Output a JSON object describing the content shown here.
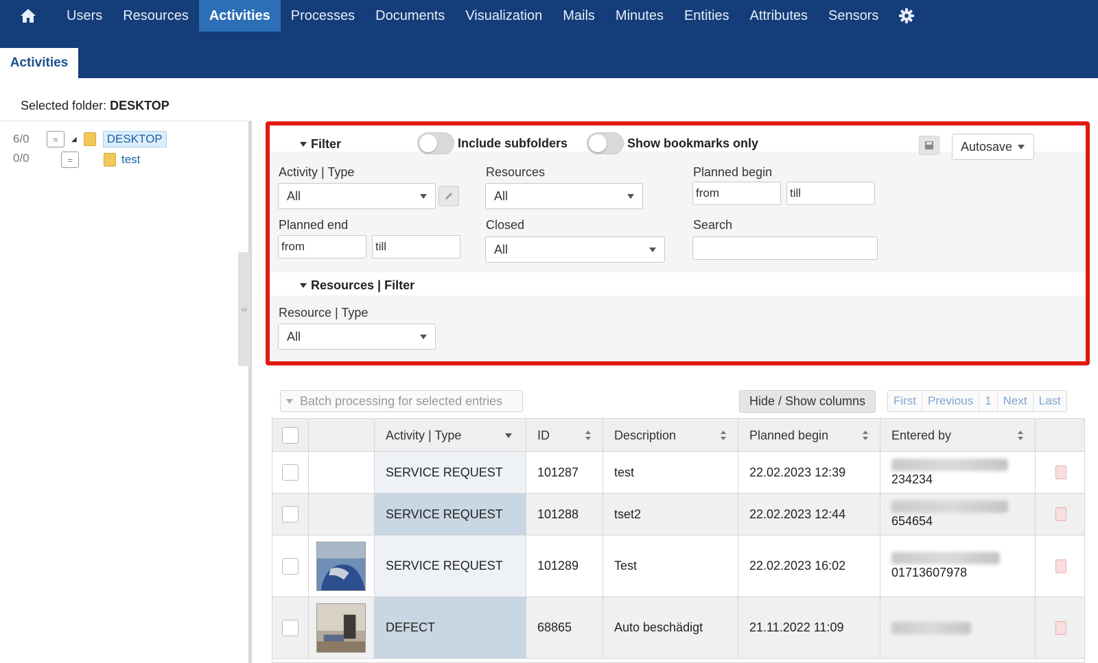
{
  "nav": {
    "items": [
      "Users",
      "Resources",
      "Activities",
      "Processes",
      "Documents",
      "Visualization",
      "Mails",
      "Minutes",
      "Entities",
      "Attributes",
      "Sensors"
    ],
    "active": "Activities"
  },
  "subtab": "Activities",
  "selected_folder": {
    "label": "Selected folder:",
    "value": "DESKTOP"
  },
  "tree": {
    "rows": [
      {
        "count": "6/0",
        "label": "DESKTOP",
        "eq": "="
      },
      {
        "count": "0/0",
        "label": "test",
        "eq": "="
      }
    ]
  },
  "filter": {
    "title": "Filter",
    "include_subfolders": "Include subfolders",
    "show_bookmarks": "Show bookmarks only",
    "autosave": "Autosave",
    "activity_type": {
      "label": "Activity | Type",
      "value": "All"
    },
    "resources": {
      "label": "Resources",
      "value": "All"
    },
    "planned_begin": {
      "label": "Planned begin",
      "from": "from",
      "till": "till"
    },
    "planned_end": {
      "label": "Planned end",
      "from": "from",
      "till": "till"
    },
    "closed": {
      "label": "Closed",
      "value": "All"
    },
    "search": {
      "label": "Search",
      "value": ""
    }
  },
  "resources_filter": {
    "title": "Resources | Filter",
    "resource_type": {
      "label": "Resource | Type",
      "value": "All"
    }
  },
  "toolbar": {
    "batch": "Batch processing for selected entries",
    "hide_show": "Hide / Show columns",
    "pager": [
      "First",
      "Previous",
      "1",
      "Next",
      "Last"
    ]
  },
  "table": {
    "columns": [
      "Activity | Type",
      "ID",
      "Description",
      "Planned begin",
      "Entered by"
    ],
    "rows": [
      {
        "type": "SERVICE REQUEST",
        "id": "101287",
        "desc": "test",
        "begin": "22.02.2023 12:39",
        "entered": "234234"
      },
      {
        "type": "SERVICE REQUEST",
        "id": "101288",
        "desc": "tset2",
        "begin": "22.02.2023 12:44",
        "entered": "654654"
      },
      {
        "type": "SERVICE REQUEST",
        "id": "101289",
        "desc": "Test",
        "begin": "22.02.2023 16:02",
        "entered": "01713607978"
      },
      {
        "type": "DEFECT",
        "id": "68865",
        "desc": "Auto beschädigt",
        "begin": "21.11.2022 11:09",
        "entered": ""
      }
    ]
  },
  "colors": {
    "nav_bg": "#143d7a",
    "nav_active": "#2d6fb6",
    "highlight_frame": "#e01a10"
  }
}
